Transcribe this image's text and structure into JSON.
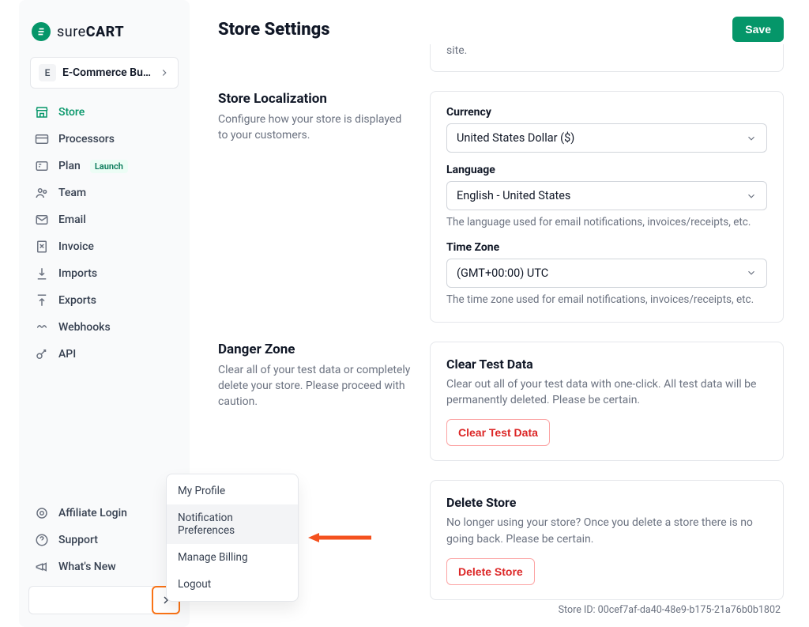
{
  "brand": {
    "name_thin": "sure",
    "name_bold": "CART"
  },
  "store_switcher": {
    "initial": "E",
    "name": "E-Commerce Bus…"
  },
  "nav": {
    "store": "Store",
    "processors": "Processors",
    "plan": "Plan",
    "plan_badge": "Launch",
    "team": "Team",
    "email": "Email",
    "invoice": "Invoice",
    "imports": "Imports",
    "exports": "Exports",
    "webhooks": "Webhooks",
    "api": "API",
    "affiliate": "Affiliate Login",
    "support": "Support",
    "whatsnew": "What's New"
  },
  "popup": {
    "profile": "My Profile",
    "notif": "Notification Preferences",
    "billing": "Manage Billing",
    "logout": "Logout"
  },
  "header": {
    "title": "Store Settings",
    "save": "Save"
  },
  "top_fragment": "site.",
  "localization": {
    "title": "Store Localization",
    "desc": "Configure how your store is displayed to your customers.",
    "currency_label": "Currency",
    "currency_value": "United States Dollar ($)",
    "language_label": "Language",
    "language_value": "English - United States",
    "language_help": "The language used for email notifications, invoices/receipts, etc.",
    "timezone_label": "Time Zone",
    "timezone_value": "(GMT+00:00) UTC",
    "timezone_help": "The time zone used for email notifications, invoices/receipts, etc."
  },
  "danger": {
    "title": "Danger Zone",
    "desc": "Clear all of your test data or completely delete your store. Please proceed with caution.",
    "clear_title": "Clear Test Data",
    "clear_desc": "Clear out all of your test data with one-click. All test data will be permanently deleted. Please be certain.",
    "clear_btn": "Clear Test Data",
    "delete_title": "Delete Store",
    "delete_desc": "No longer using your store? Once you delete a store there is no going back. Please be certain.",
    "delete_btn": "Delete Store"
  },
  "footer": {
    "store_id_label": "Store ID: ",
    "store_id": "00cef7af-da40-48e9-b175-21a76b0b1802"
  }
}
